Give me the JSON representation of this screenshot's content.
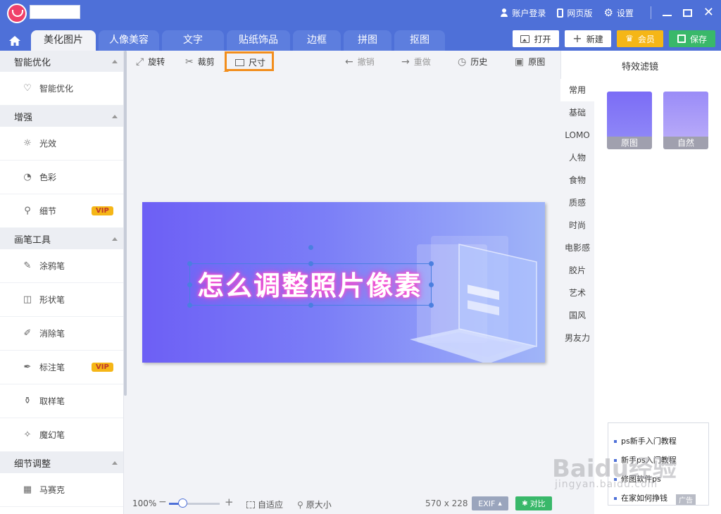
{
  "titlebar": {
    "account_login": "账户登录",
    "web_version": "网页版",
    "settings": "设置"
  },
  "tabs": [
    "美化图片",
    "人像美容",
    "文字",
    "贴纸饰品",
    "边框",
    "拼图",
    "抠图"
  ],
  "actions": {
    "open": "打开",
    "new": "新建",
    "vip": "会员",
    "save": "保存"
  },
  "sidebar": {
    "sections": [
      {
        "title": "智能优化",
        "items": [
          {
            "label": "智能优化",
            "icon": "bulb-icon"
          }
        ]
      },
      {
        "title": "增强",
        "items": [
          {
            "label": "光效",
            "icon": "sun-icon"
          },
          {
            "label": "色彩",
            "icon": "palette-icon"
          },
          {
            "label": "细节",
            "icon": "magnifier-icon",
            "vip": "VIP"
          }
        ]
      },
      {
        "title": "画笔工具",
        "items": [
          {
            "label": "涂鸦笔",
            "icon": "brush-icon"
          },
          {
            "label": "形状笔",
            "icon": "shape-icon"
          },
          {
            "label": "消除笔",
            "icon": "eraser-icon"
          },
          {
            "label": "标注笔",
            "icon": "pen-icon",
            "vip": "VIP"
          },
          {
            "label": "取样笔",
            "icon": "dropper-icon"
          },
          {
            "label": "魔幻笔",
            "icon": "magic-wand-icon"
          }
        ]
      },
      {
        "title": "细节调整",
        "items": [
          {
            "label": "马赛克",
            "icon": "mosaic-icon"
          }
        ]
      }
    ]
  },
  "toolbar": {
    "rotate": "旋转",
    "crop": "裁剪",
    "size": "尺寸",
    "undo": "撤销",
    "redo": "重做",
    "history": "历史",
    "original": "原图"
  },
  "canvas": {
    "banner_text": "怎么调整照片像素"
  },
  "status": {
    "zoom": "100%",
    "fit": "自适应",
    "actual_size": "原大小",
    "dimensions": "570 x 228",
    "exif": "EXIF",
    "compare": "对比"
  },
  "right_panel": {
    "title": "特效滤镜",
    "categories": [
      "常用",
      "基础",
      "LOMO",
      "人物",
      "食物",
      "质感",
      "时尚",
      "电影感",
      "胶片",
      "艺术",
      "国风",
      "男友力"
    ],
    "filters": [
      {
        "label": "原图",
        "color_top": "#7b6cf6",
        "color_bottom": "#8e86f7"
      },
      {
        "label": "自然",
        "color_top": "#9a8cf7",
        "color_bottom": "#b6a8f9"
      }
    ]
  },
  "ad": {
    "items": [
      "ps新手入门教程",
      "新手ps入门教程",
      "修图软件ps",
      "在家如何挣钱"
    ],
    "tag": "广告"
  },
  "watermark": {
    "main": "Baidu经验",
    "sub": "jingyan.baidu.com"
  },
  "colors": {
    "brand": "#4e70d8",
    "highlight": "#f28e1d",
    "vip": "#f5b617",
    "save": "#39b86a"
  }
}
